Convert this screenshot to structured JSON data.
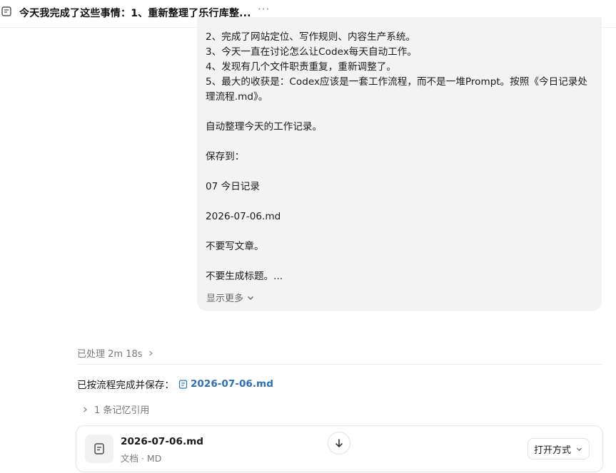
{
  "header": {
    "title": "今天我完成了这些事情：1、重新整理了乐行库整...",
    "more": "···"
  },
  "message": {
    "lines": [
      "2、完成了网站定位、写作规则、内容生产系统。",
      "3、今天一直在讨论怎么让Codex每天自动工作。",
      "4、发现有几个文件职责重复，重新调整了。",
      "5、最大的收获是：Codex应该是一套工作流程，而不是一堆Prompt。按照《今日记录处",
      "理流程.md》。",
      "",
      "自动整理今天的工作记录。",
      "",
      "保存到：",
      "",
      "07 今日记录",
      "",
      "2026-07-06.md",
      "",
      "不要写文章。",
      "",
      "不要生成标题。..."
    ],
    "show_more": "显示更多"
  },
  "processed": {
    "label": "已处理 2m 18s"
  },
  "result": {
    "prefix": "已按流程完成并保存：",
    "file_link": "2026-07-06.md"
  },
  "memory": {
    "label": "1 条记忆引用"
  },
  "file_card": {
    "name": "2026-07-06.md",
    "meta": "文档 · MD",
    "open_with": "打开方式"
  }
}
